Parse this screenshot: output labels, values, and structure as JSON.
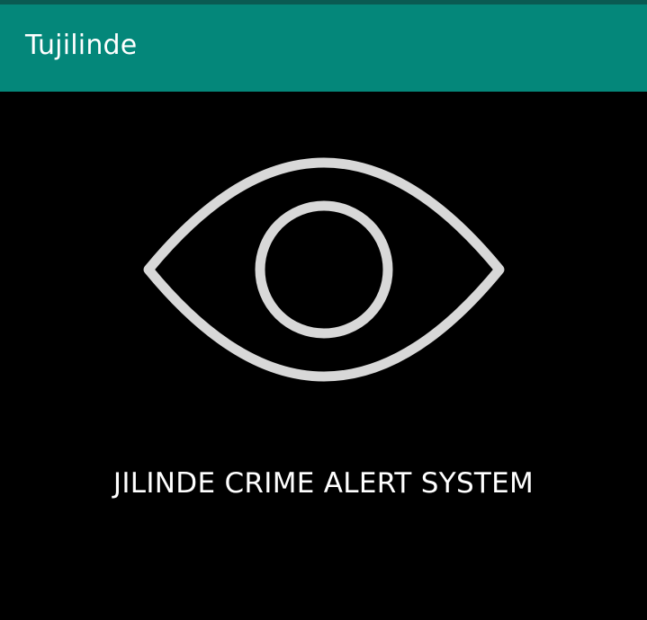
{
  "app_bar": {
    "title": "Tujilinde",
    "background_color": "#04877a",
    "status_strip_color": "#0a5a52"
  },
  "splash": {
    "logo_icon": "eye-icon",
    "logo_color": "#d8d8d8",
    "tagline": "JILINDE CRIME ALERT SYSTEM",
    "background_color": "#000000"
  }
}
